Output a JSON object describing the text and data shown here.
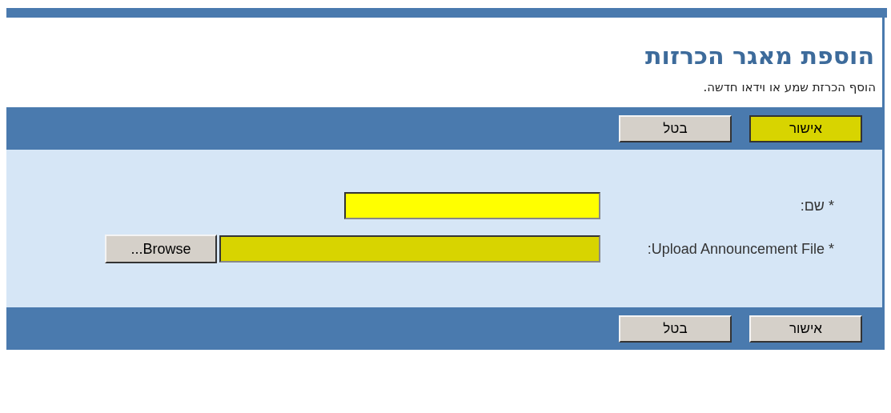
{
  "title": "הוספת מאגר הכרזות",
  "subtitle": "הוסף הכרזת שמע או וידאו חדשה.",
  "top_buttons": [
    {
      "label": "אישור",
      "highlighted": true
    },
    {
      "label": "בטל",
      "highlighted": false
    }
  ],
  "fields": [
    {
      "kind": "text",
      "label": "* שם:",
      "highlighted": true
    },
    {
      "kind": "file",
      "label": "* Upload Announcement File:",
      "browse_label": "Browse...",
      "highlighted": true
    }
  ],
  "bottom_buttons": [
    {
      "label": "אישור",
      "highlighted": false
    },
    {
      "label": "בטל",
      "highlighted": false
    }
  ]
}
